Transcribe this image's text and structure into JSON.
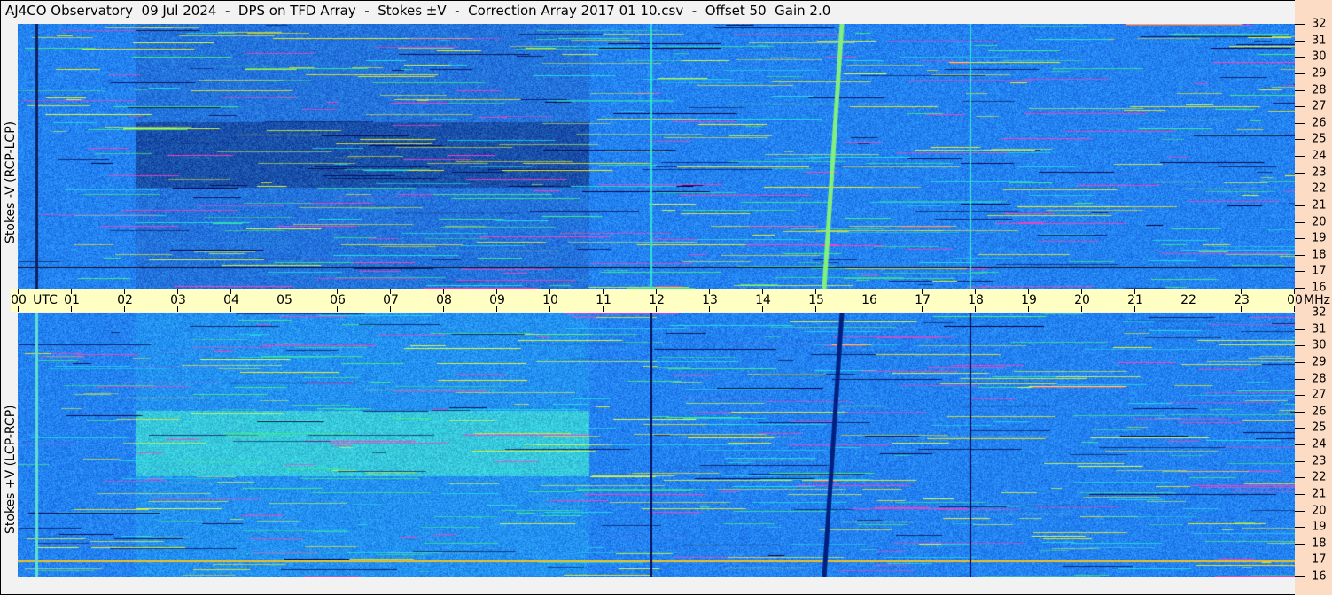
{
  "title": "AJ4CO Observatory  09 Jul 2024  -  DPS on TFD Array  -  Stokes ±V  -  Correction Array 2017 01 10.csv  -  Offset 50  Gain 2.0",
  "top_panel": {
    "ylabel": "Stokes -V (RCP-LCP)"
  },
  "bottom_panel": {
    "ylabel": "Stokes +V (LCP-RCP)"
  },
  "time_axis": {
    "utc_label": "UTC",
    "unit_label": "MHz",
    "hours": [
      "00",
      "01",
      "02",
      "03",
      "04",
      "05",
      "06",
      "07",
      "08",
      "09",
      "10",
      "11",
      "12",
      "13",
      "14",
      "15",
      "16",
      "17",
      "18",
      "19",
      "20",
      "21",
      "22",
      "23",
      "00"
    ]
  },
  "freq_axis": {
    "ticks": [
      "32",
      "31",
      "30",
      "29",
      "28",
      "27",
      "26",
      "25",
      "24",
      "23",
      "22",
      "21",
      "20",
      "19",
      "18",
      "17",
      "16"
    ]
  },
  "colors": {
    "background_blue": "#1a6ee8",
    "axis_band": "#ffffc4",
    "scale_band": "#fcdcc4"
  }
}
